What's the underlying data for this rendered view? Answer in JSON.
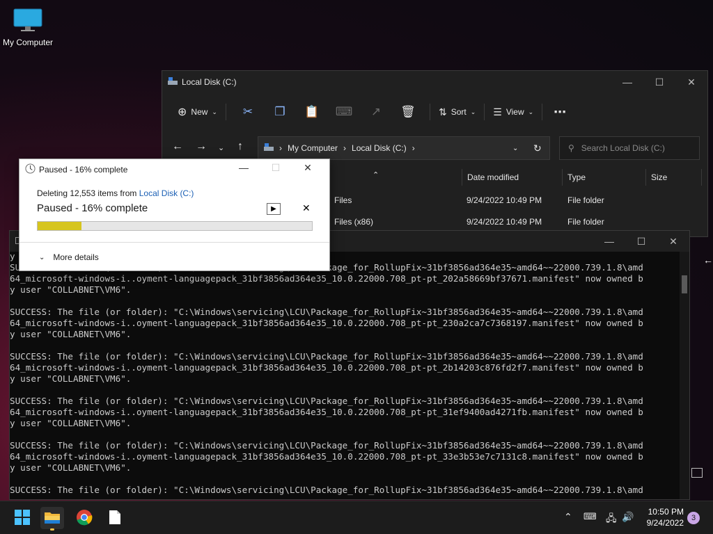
{
  "desktop": {
    "icon_label": "My Computer"
  },
  "explorer": {
    "title": "Local Disk (C:)",
    "toolbar": {
      "new_label": "New",
      "sort_label": "Sort",
      "view_label": "View"
    },
    "address": {
      "root": "My Computer",
      "current": "Local Disk (C:)"
    },
    "search": {
      "placeholder": "Search Local Disk (C:)"
    },
    "columns": [
      "Date modified",
      "Type",
      "Size"
    ],
    "rows": [
      {
        "name": "Files",
        "date": "9/24/2022 10:49 PM",
        "type": "File folder"
      },
      {
        "name": "Files (x86)",
        "date": "9/24/2022 10:49 PM",
        "type": "File folder"
      }
    ]
  },
  "progress": {
    "title": "Paused - 16% complete",
    "deleting_prefix": "Deleting 12,553 items from",
    "deleting_link": "Local Disk (C:)",
    "status": "Paused - 16% complete",
    "percent": 16,
    "more_details": "More details"
  },
  "console": {
    "first_line": "y",
    "entries": [
      {
        "l1": "SUCCESS: The file (or folder): \"C:\\Windows\\servicing\\LCU\\Package_for_RollupFix~31bf3856ad364e35~amd64~~22000.739.1.8\\amd",
        "l2": "64_microsoft-windows-i..oyment-languagepack_31bf3856ad364e35_10.0.22000.708_pt-pt_202a58669bf37671.manifest\" now owned b",
        "l3": "y user \"COLLABNET\\VM6\"."
      },
      {
        "l1": "SUCCESS: The file (or folder): \"C:\\Windows\\servicing\\LCU\\Package_for_RollupFix~31bf3856ad364e35~amd64~~22000.739.1.8\\amd",
        "l2": "64_microsoft-windows-i..oyment-languagepack_31bf3856ad364e35_10.0.22000.708_pt-pt_230a2ca7c7368197.manifest\" now owned b",
        "l3": "y user \"COLLABNET\\VM6\"."
      },
      {
        "l1": "SUCCESS: The file (or folder): \"C:\\Windows\\servicing\\LCU\\Package_for_RollupFix~31bf3856ad364e35~amd64~~22000.739.1.8\\amd",
        "l2": "64_microsoft-windows-i..oyment-languagepack_31bf3856ad364e35_10.0.22000.708_pt-pt_2b14203c876fd2f7.manifest\" now owned b",
        "l3": "y user \"COLLABNET\\VM6\"."
      },
      {
        "l1": "SUCCESS: The file (or folder): \"C:\\Windows\\servicing\\LCU\\Package_for_RollupFix~31bf3856ad364e35~amd64~~22000.739.1.8\\amd",
        "l2": "64_microsoft-windows-i..oyment-languagepack_31bf3856ad364e35_10.0.22000.708_pt-pt_31ef9400ad4271fb.manifest\" now owned b",
        "l3": "y user \"COLLABNET\\VM6\"."
      },
      {
        "l1": "SUCCESS: The file (or folder): \"C:\\Windows\\servicing\\LCU\\Package_for_RollupFix~31bf3856ad364e35~amd64~~22000.739.1.8\\amd",
        "l2": "64_microsoft-windows-i..oyment-languagepack_31bf3856ad364e35_10.0.22000.708_pt-pt_33e3b53e7c7131c8.manifest\" now owned b",
        "l3": "y user \"COLLABNET\\VM6\"."
      }
    ],
    "last_line": "SUCCESS: The file (or folder): \"C:\\Windows\\servicing\\LCU\\Package_for_RollupFix~31bf3856ad364e35~amd64~~22000.739.1.8\\amd"
  },
  "taskbar": {
    "time": "10:50 PM",
    "date": "9/24/2022",
    "notification_count": "3"
  },
  "colors": {
    "progress_fill": "#d6c51e",
    "link": "#1a5fb4"
  }
}
